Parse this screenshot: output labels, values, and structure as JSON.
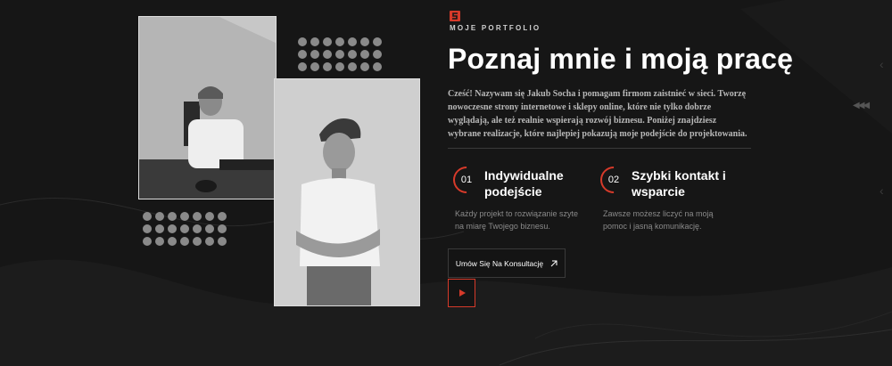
{
  "hero": {
    "eyebrow": "MOJE PORTFOLIO",
    "title": "Poznaj mnie i moją pracę",
    "intro": "Cześć! Nazywam się Jakub Socha i pomagam firmom zaistnieć w sieci. Tworzę nowoczesne strony internetowe i sklepy online, które nie tylko dobrze wyglądają, ale też realnie wspierają rozwój biznesu. Poniżej znajdziesz wybrane realizacje, które najlepiej pokazują moje podejście do projektowania."
  },
  "features": [
    {
      "number": "01",
      "title_line1": "Indywidualne",
      "title_line2": "podejście",
      "desc": "Każdy projekt to rozwiązanie szyte na miarę Twojego biznesu."
    },
    {
      "number": "02",
      "title_line1": "Szybki kontakt i",
      "title_line2": "wsparcie",
      "desc": "Zawsze możesz liczyć na moją pomoc i jasną komunikację."
    }
  ],
  "cta": {
    "label": "Umów Się Na Konsultację"
  },
  "colors": {
    "accent": "#d63a2a",
    "background": "#161616"
  },
  "icons": {
    "logo": "s-logo-icon",
    "arrow": "arrow-up-right-icon",
    "play": "play-icon"
  }
}
